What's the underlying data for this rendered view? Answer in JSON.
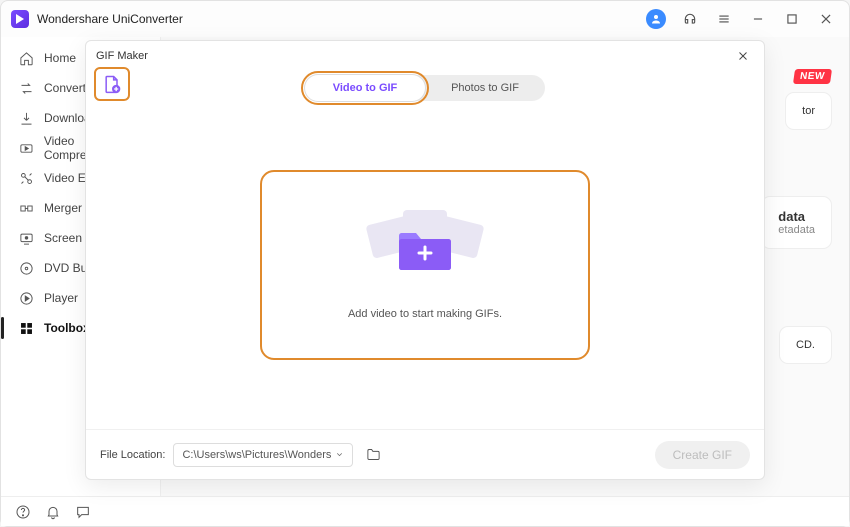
{
  "app": {
    "title": "Wondershare UniConverter"
  },
  "sidebar": {
    "items": [
      {
        "label": "Home"
      },
      {
        "label": "Converter"
      },
      {
        "label": "Downloader"
      },
      {
        "label": "Video Compressor"
      },
      {
        "label": "Video Editor"
      },
      {
        "label": "Merger"
      },
      {
        "label": "Screen Recorder"
      },
      {
        "label": "DVD Burner"
      },
      {
        "label": "Player"
      },
      {
        "label": "Toolbox"
      }
    ]
  },
  "back": {
    "new_badge": "NEW",
    "card_tor": "tor",
    "card_data_title": "data",
    "card_data_sub": "etadata",
    "card_cd": "CD."
  },
  "modal": {
    "title": "GIF Maker",
    "tabs": {
      "video": "Video to GIF",
      "photos": "Photos to GIF"
    },
    "dropzone_text": "Add video to start making GIFs.",
    "footer": {
      "label": "File Location:",
      "path": "C:\\Users\\ws\\Pictures\\Wonders",
      "create_label": "Create GIF"
    }
  },
  "icons": {
    "add_file": "add-file-icon",
    "close": "close-icon",
    "folder": "folder-icon",
    "chevron_down": "chevron-down-icon"
  }
}
